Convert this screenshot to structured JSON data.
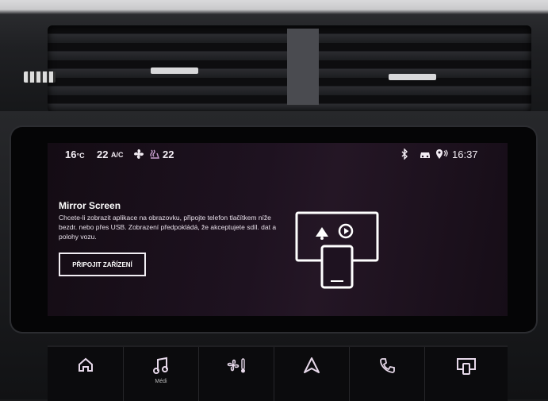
{
  "status_bar": {
    "temp_left": "16",
    "temp_unit": "°C",
    "fan": "22",
    "ac": "A/C",
    "temp_right": "22",
    "time": "16:37"
  },
  "icons": {
    "fan": "fan-icon",
    "seat_heat": "seat-heat-icon",
    "bluetooth": "bluetooth-icon",
    "car": "car-icon",
    "location": "location-icon",
    "cast": "cast-icon",
    "home": "home-icon",
    "media": "music-note-icon",
    "climate": "climate-icon",
    "navigation": "navigation-arrow-icon",
    "phone": "phone-icon",
    "mirror": "mirror-screen-icon"
  },
  "content": {
    "title": "Mirror Screen",
    "description": "Chcete-li zobrazit aplikace na obrazovku, připojte telefon tlačítkem níže bezdr. nebo přes USB. Zobrazení předpokládá, že akceptujete sdíl. dat a polohy vozu.",
    "connect_button": "PŘIPOJIT ZAŘÍZENÍ"
  },
  "touchbar": {
    "items": [
      {
        "name": "home",
        "label": ""
      },
      {
        "name": "media",
        "label": "Médi"
      },
      {
        "name": "climate",
        "label": ""
      },
      {
        "name": "navigation",
        "label": ""
      },
      {
        "name": "phone",
        "label": ""
      },
      {
        "name": "mirror",
        "label": ""
      }
    ]
  },
  "colors": {
    "screen_bg": "#1e1220",
    "text": "#f2ecf3",
    "accent_line": "#ffffff"
  }
}
